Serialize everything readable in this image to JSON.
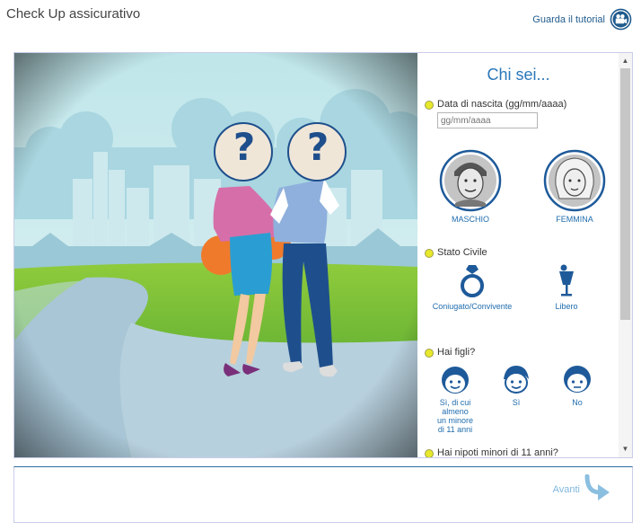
{
  "app": {
    "title": "Check Up assicurativo"
  },
  "header": {
    "tutorial_label": "Guarda il tutorial",
    "tutorial_icon": "video-camera-icon"
  },
  "scene": {
    "question_mark": "?"
  },
  "panel": {
    "title": "Chi sei...",
    "birth": {
      "label": "Data di nascita (gg/mm/aaaa)",
      "placeholder": "gg/mm/aaaa",
      "value": ""
    },
    "gender": {
      "options": [
        {
          "label": "MASCHIO",
          "icon": "male-avatar-icon"
        },
        {
          "label": "FEMMINA",
          "icon": "female-avatar-icon"
        }
      ]
    },
    "civil_status": {
      "label": "Stato Civile",
      "options": [
        {
          "label": "Coniugato/Convivente",
          "icon": "ring-icon"
        },
        {
          "label": "Libero",
          "icon": "cocktail-icon"
        }
      ]
    },
    "children": {
      "label": "Hai figli?",
      "options": [
        {
          "label": "Sì, di cui almeno un minore di 11 anni",
          "icon": "child-face-icon"
        },
        {
          "label": "Sì",
          "icon": "child-face-icon"
        },
        {
          "label": "No",
          "icon": "child-face-icon"
        }
      ]
    },
    "grandchildren": {
      "label": "Hai nipoti minori di 11 anni?"
    }
  },
  "footer": {
    "next_label": "Avanti",
    "next_icon": "curved-arrow-icon"
  },
  "colors": {
    "accent": "#2a77b8",
    "bullet": "#e7e82b",
    "border": "#c9cde8"
  }
}
